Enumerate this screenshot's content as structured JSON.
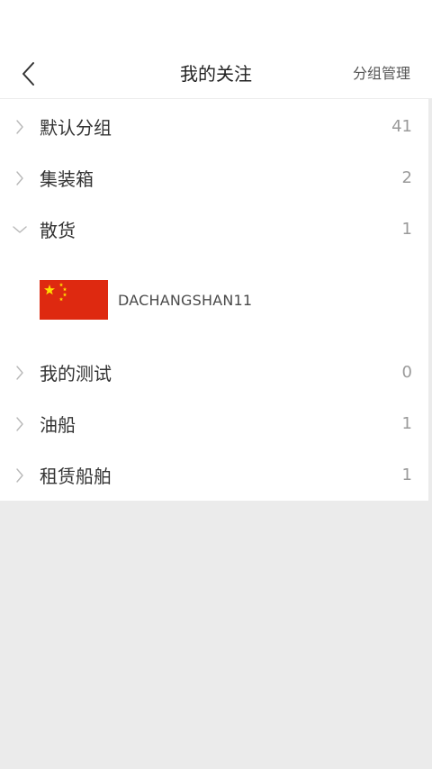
{
  "header": {
    "title": "我的关注",
    "manage_label": "分组管理",
    "back_icon": "chevron-left-icon"
  },
  "groups": [
    {
      "name": "默认分组",
      "count": "41",
      "expanded": false
    },
    {
      "name": "集装箱",
      "count": "2",
      "expanded": false
    },
    {
      "name": "散货",
      "count": "1",
      "expanded": true
    },
    {
      "name": "我的测试",
      "count": "0",
      "expanded": false
    },
    {
      "name": "油船",
      "count": "1",
      "expanded": false
    },
    {
      "name": "租赁船舶",
      "count": "1",
      "expanded": false
    }
  ],
  "expanded_group_ships": [
    {
      "name": "DACHANGSHAN11",
      "flag_icon": "china-flag-icon"
    }
  ],
  "colors": {
    "background": "#ebebeb",
    "panel": "#ffffff",
    "text_primary": "#333333",
    "text_secondary": "#9a9a9a",
    "flag_red": "#de2910",
    "flag_yellow": "#ffde00"
  }
}
